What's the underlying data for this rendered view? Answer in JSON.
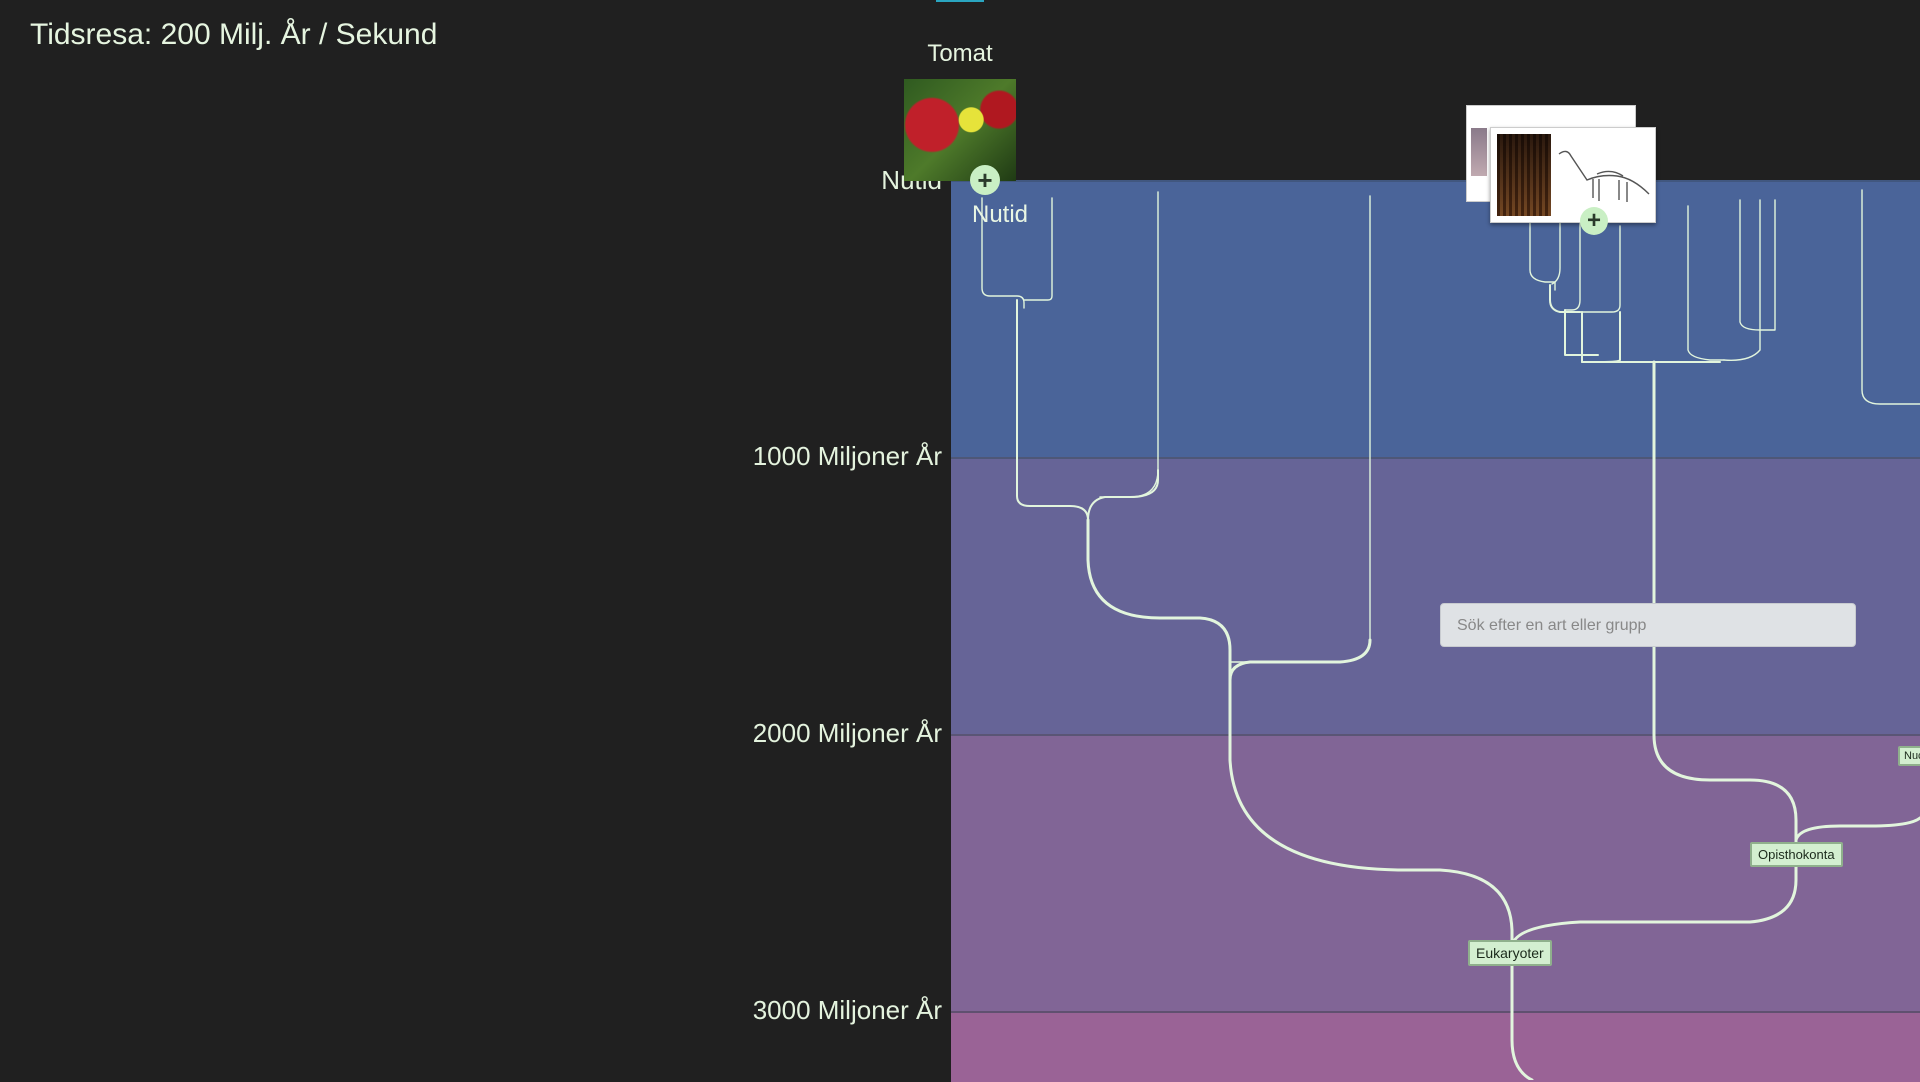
{
  "header": {
    "title": "Tidsresa: 200 Milj. År / Sekund"
  },
  "timeline": {
    "labels": [
      "Nutid",
      "1000 Miljoner År",
      "2000 Miljoner År",
      "3000 Miljoner År"
    ],
    "inner_now_label": "Nutid"
  },
  "featured": {
    "title": "Tomat",
    "image_icon": "tomato-flower-photo"
  },
  "expand_icon": "plus-icon",
  "expand_symbol": "+",
  "gallery_stack": {
    "icon": "dinosaur-and-museum-images"
  },
  "search": {
    "placeholder": "Sök efter en art eller grupp",
    "value": ""
  },
  "nodes": {
    "eukaryotes": "Eukaryoter",
    "opisthokonta": "Opisthokonta",
    "partial": "Nuc"
  },
  "colors": {
    "background": "#202020",
    "band_0": "#4a6499",
    "band_1": "#666497",
    "band_2": "#816596",
    "band_3": "#9a6396",
    "branch": "#e2f5dd",
    "tag_fill": "#d3efd0"
  }
}
